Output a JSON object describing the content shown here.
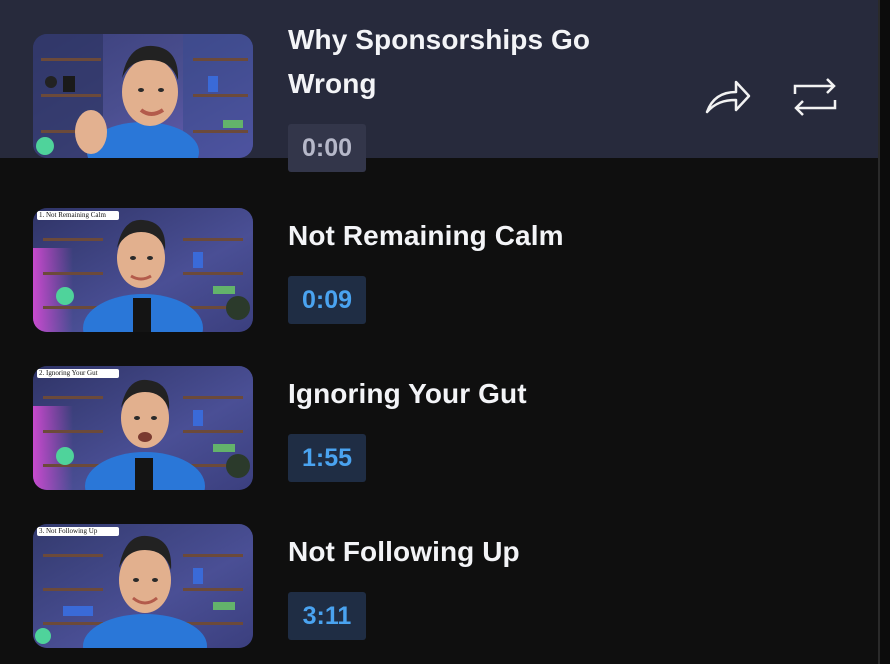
{
  "chapters": [
    {
      "title": "Why Sponsorships Go Wrong",
      "time": "0:00",
      "active": true,
      "overlay": ""
    },
    {
      "title": "Not Remaining Calm",
      "time": "0:09",
      "active": false,
      "overlay": "1. Not Remaining Calm"
    },
    {
      "title": "Ignoring Your Gut",
      "time": "1:55",
      "active": false,
      "overlay": "2. Ignoring Your Gut"
    },
    {
      "title": "Not Following Up",
      "time": "3:11",
      "active": false,
      "overlay": "3. Not Following Up"
    }
  ],
  "actions": {
    "share_icon": "share-arrow-icon",
    "repeat_icon": "repeat-icon"
  },
  "colors": {
    "panel_bg": "#0f0f0f",
    "active_row_bg": "#272a3c",
    "timestamp_link": "#4aa3f0",
    "timestamp_link_bg": "#1f2d44",
    "timestamp_muted": "#b6b8c9",
    "title_text": "#f3f4f7"
  }
}
